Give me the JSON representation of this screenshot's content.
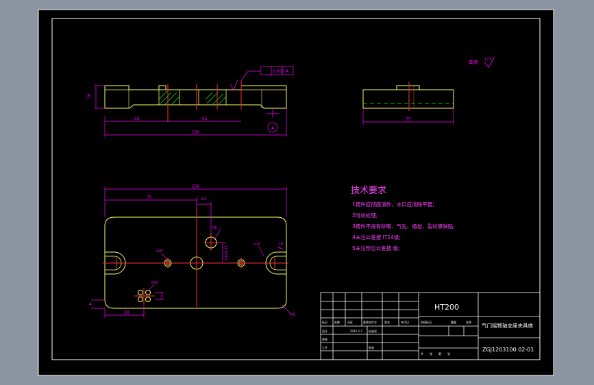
{
  "colors": {
    "background": "#000000",
    "viewport": "#8c96a3",
    "outline": "#ffffff",
    "part": "#ffff66",
    "dimension": "#ff00ff",
    "center": "#ff3030",
    "hatch": "#00ff00",
    "title_text": "#ffffff",
    "notes": "#ff44ff"
  },
  "front_view": {
    "dim_height": "20",
    "dim_left": "32",
    "dim_mid": "61",
    "dim_total": "150",
    "datum": "A",
    "tolerance_value": "0.050",
    "tolerance_datum": "A"
  },
  "side_view": {
    "dim_width": "75"
  },
  "roughness_note": {
    "label": "其余",
    "value": "12.5"
  },
  "plan_view": {
    "dim_total": "150",
    "dim_75": "75",
    "dim_13": "13",
    "dim_30": "30",
    "dim_small_a": "R6",
    "dim_small_b": "4x6",
    "dim_r10": "R10",
    "dim_10": "10",
    "dim_r5": "R5",
    "dim_vert": "10+0.03",
    "dim_left_mark": "4",
    "dim_hole_pitch": "6x6"
  },
  "tech_requirements": {
    "title": "技术要求",
    "items": [
      "1铸件应彻底清砂，水口应清除平整;",
      "2时效处理;",
      "3铸件不得有砂眼、气孔、缩松、裂纹等缺陷;",
      "4未注公差按 IT14级;",
      "5未注形位公差按 级;"
    ]
  },
  "title_block": {
    "material": "HT200",
    "part_name": "气门摇臂轴支座夹具体",
    "drawing_no": "ZGJ1203100 02-01",
    "date": "2012.2.7",
    "row_labels": [
      "标记",
      "处数",
      "分区",
      "更改文件号",
      "签名",
      "年月日"
    ],
    "role_labels": [
      "设计",
      "标准化",
      "审核",
      "工艺",
      "批准"
    ],
    "stage_label": "阶段标记",
    "sheet_labels": [
      "共",
      "张",
      "第",
      "张"
    ],
    "weight_label": "重量",
    "scale_label": "比例"
  }
}
